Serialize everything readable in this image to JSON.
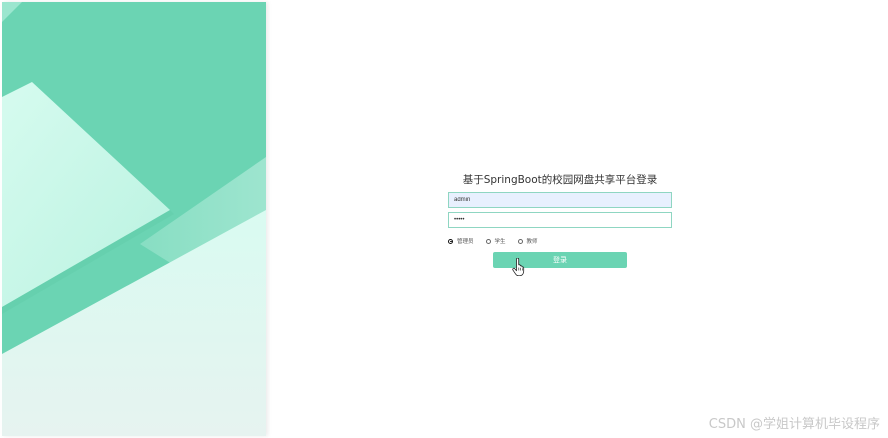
{
  "login": {
    "title": "基于SpringBoot的校园网盘共享平台登录",
    "username_value": "admin",
    "password_value": "•••••",
    "roles": [
      {
        "label": "管理员",
        "checked": true
      },
      {
        "label": "学生",
        "checked": false
      },
      {
        "label": "教师",
        "checked": false
      }
    ],
    "submit_label": "登录"
  },
  "watermark": "CSDN @学姐计算机毕设程序",
  "colors": {
    "accent": "#6bd4b3",
    "input_border": "#8fd6c2",
    "autofill_bg": "#e8f0fe"
  },
  "icons": {
    "cursor": "hand-pointer-icon"
  }
}
